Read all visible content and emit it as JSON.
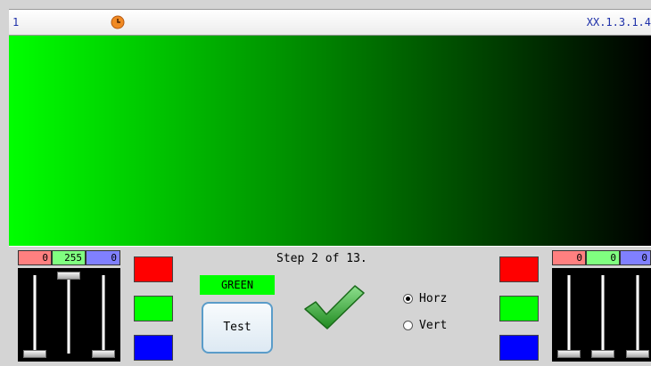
{
  "titlebar": {
    "index": "1",
    "version": "XX.1.3.1.4"
  },
  "main": {
    "step": "Step 2 of 13.",
    "channel": "GREEN",
    "test_label": "Test",
    "orientation": {
      "options": [
        {
          "label": "Horz",
          "selected": true
        },
        {
          "label": "Vert",
          "selected": false
        }
      ]
    }
  },
  "left_rgb": {
    "values": {
      "red": "0",
      "green": "255",
      "blue": "0"
    },
    "levels": {
      "red": 0,
      "green": 255,
      "blue": 0
    }
  },
  "right_rgb": {
    "values": {
      "red": "0",
      "green": "0",
      "blue": "0"
    },
    "levels": {
      "red": 0,
      "green": 0,
      "blue": 0
    }
  },
  "gradient": {
    "from": "#00ff00",
    "to": "#000000",
    "direction": "horizontal"
  },
  "colors": {
    "red": "#ff0000",
    "green": "#00ff00",
    "blue": "#0000ff"
  }
}
